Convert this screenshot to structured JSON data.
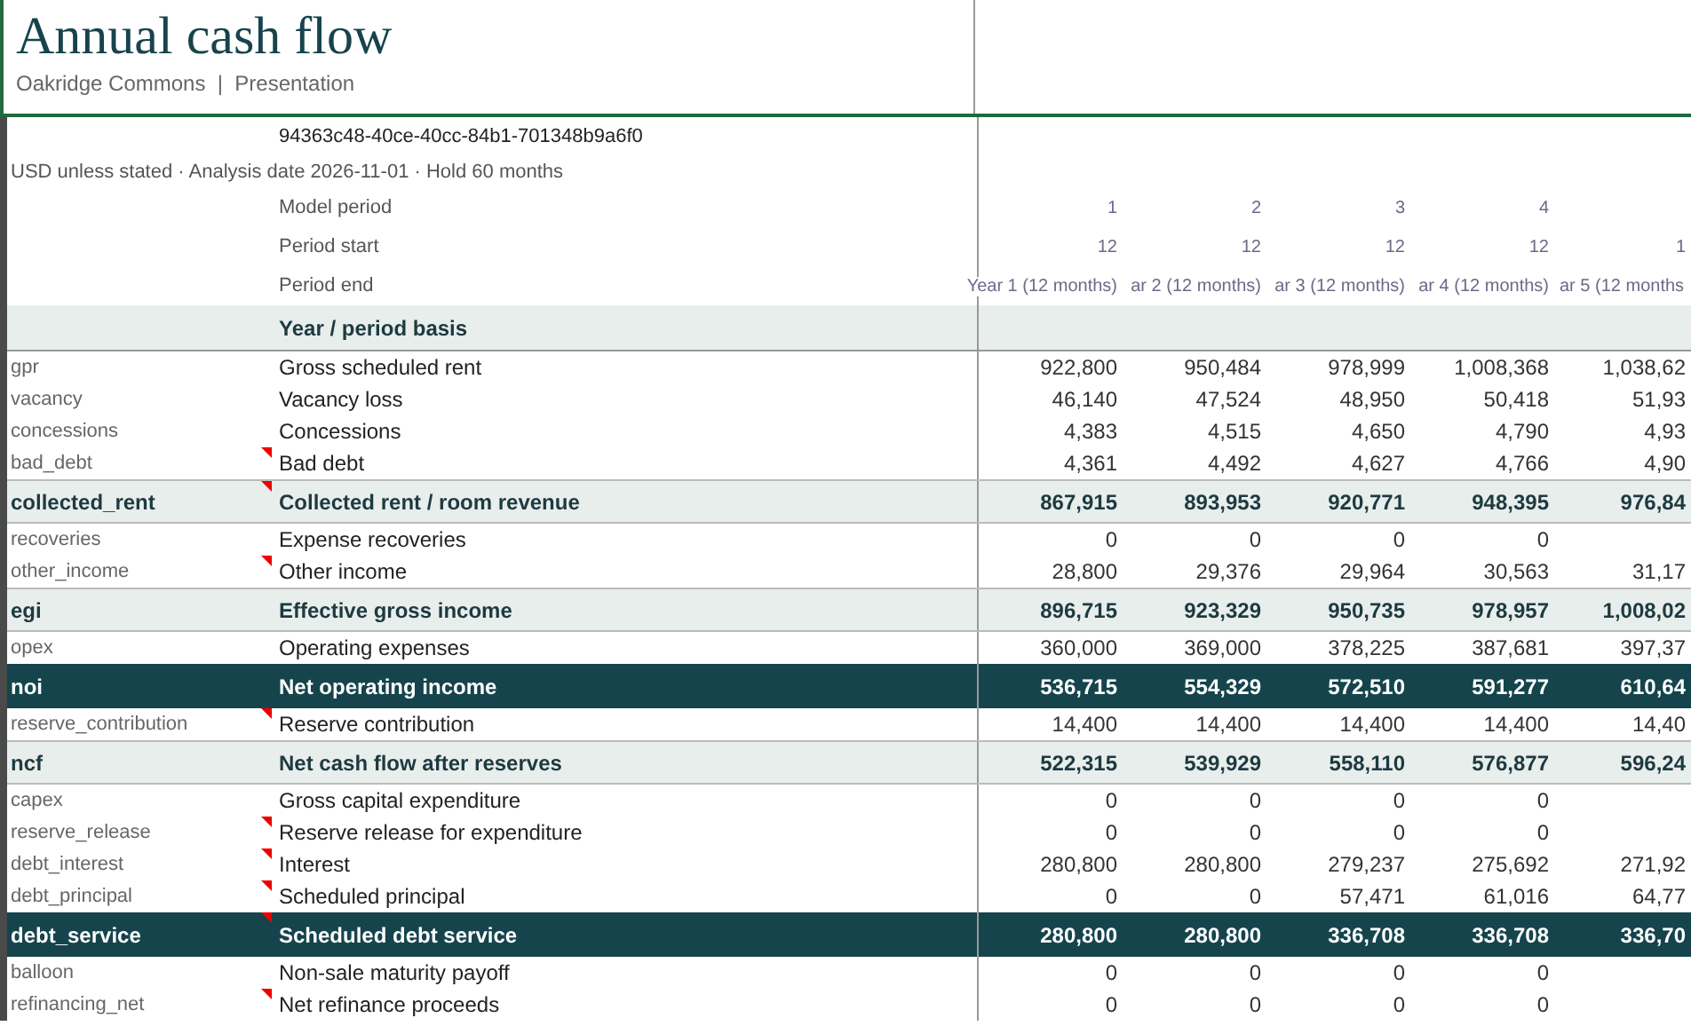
{
  "title": "Annual cash flow",
  "subtitle": "Oakridge Commons  |  Presentation",
  "scenario_id": "94363c48-40ce-40cc-84b1-701348b9a6f0",
  "note": "USD unless stated · Analysis date 2026-11-01 · Hold 60 months",
  "period_rows": [
    {
      "label": "Model period",
      "values": [
        "1",
        "2",
        "3",
        "4"
      ]
    },
    {
      "label": "Period start",
      "values": [
        "12",
        "12",
        "12",
        "12",
        "1"
      ]
    },
    {
      "label": "Period end",
      "values": [
        "Year 1 (12 months)",
        "ar 2 (12 months)",
        "ar 3 (12 months)",
        "ar 4 (12 months)",
        "ar 5 (12 months"
      ]
    }
  ],
  "section": "Year / period basis",
  "rows": [
    {
      "key": "gpr",
      "label": "Gross scheduled rent",
      "kind": "line",
      "comment": false,
      "values": [
        "922,800",
        "950,484",
        "978,999",
        "1,008,368",
        "1,038,62"
      ]
    },
    {
      "key": "vacancy",
      "label": "Vacancy loss",
      "kind": "line",
      "comment": false,
      "values": [
        "46,140",
        "47,524",
        "48,950",
        "50,418",
        "51,93"
      ]
    },
    {
      "key": "concessions",
      "label": "Concessions",
      "kind": "line",
      "comment": false,
      "values": [
        "4,383",
        "4,515",
        "4,650",
        "4,790",
        "4,93"
      ]
    },
    {
      "key": "bad_debt",
      "label": "Bad debt",
      "kind": "line",
      "comment": true,
      "values": [
        "4,361",
        "4,492",
        "4,627",
        "4,766",
        "4,90"
      ]
    },
    {
      "key": "collected_rent",
      "label": "Collected rent / room revenue",
      "kind": "subtotal",
      "comment": true,
      "values": [
        "867,915",
        "893,953",
        "920,771",
        "948,395",
        "976,84"
      ]
    },
    {
      "key": "recoveries",
      "label": "Expense recoveries",
      "kind": "line",
      "comment": false,
      "values": [
        "0",
        "0",
        "0",
        "0"
      ]
    },
    {
      "key": "other_income",
      "label": "Other income",
      "kind": "line",
      "comment": true,
      "values": [
        "28,800",
        "29,376",
        "29,964",
        "30,563",
        "31,17"
      ]
    },
    {
      "key": "egi",
      "label": "Effective gross income",
      "kind": "subtotal",
      "comment": false,
      "values": [
        "896,715",
        "923,329",
        "950,735",
        "978,957",
        "1,008,02"
      ]
    },
    {
      "key": "opex",
      "label": "Operating expenses",
      "kind": "line",
      "comment": false,
      "values": [
        "360,000",
        "369,000",
        "378,225",
        "387,681",
        "397,37"
      ]
    },
    {
      "key": "noi",
      "label": "Net operating income",
      "kind": "total",
      "comment": false,
      "values": [
        "536,715",
        "554,329",
        "572,510",
        "591,277",
        "610,64"
      ]
    },
    {
      "key": "reserve_contribution",
      "label": "Reserve contribution",
      "kind": "line",
      "comment": true,
      "values": [
        "14,400",
        "14,400",
        "14,400",
        "14,400",
        "14,40"
      ]
    },
    {
      "key": "ncf",
      "label": "Net cash flow after reserves",
      "kind": "subtotal",
      "comment": false,
      "values": [
        "522,315",
        "539,929",
        "558,110",
        "576,877",
        "596,24"
      ]
    },
    {
      "key": "capex",
      "label": "Gross capital expenditure",
      "kind": "line",
      "comment": false,
      "values": [
        "0",
        "0",
        "0",
        "0"
      ]
    },
    {
      "key": "reserve_release",
      "label": "Reserve release for expenditure",
      "kind": "line",
      "comment": true,
      "values": [
        "0",
        "0",
        "0",
        "0"
      ]
    },
    {
      "key": "debt_interest",
      "label": "Interest",
      "kind": "line",
      "comment": true,
      "values": [
        "280,800",
        "280,800",
        "279,237",
        "275,692",
        "271,92"
      ]
    },
    {
      "key": "debt_principal",
      "label": "Scheduled principal",
      "kind": "line",
      "comment": true,
      "values": [
        "0",
        "0",
        "57,471",
        "61,016",
        "64,77"
      ]
    },
    {
      "key": "debt_service",
      "label": "Scheduled debt service",
      "kind": "total",
      "comment": true,
      "values": [
        "280,800",
        "280,800",
        "336,708",
        "336,708",
        "336,70"
      ]
    },
    {
      "key": "balloon",
      "label": "Non-sale maturity payoff",
      "kind": "line",
      "comment": false,
      "values": [
        "0",
        "0",
        "0",
        "0"
      ]
    },
    {
      "key": "refinancing_net",
      "label": "Net refinance proceeds",
      "kind": "line",
      "comment": true,
      "values": [
        "0",
        "0",
        "0",
        "0"
      ]
    }
  ]
}
